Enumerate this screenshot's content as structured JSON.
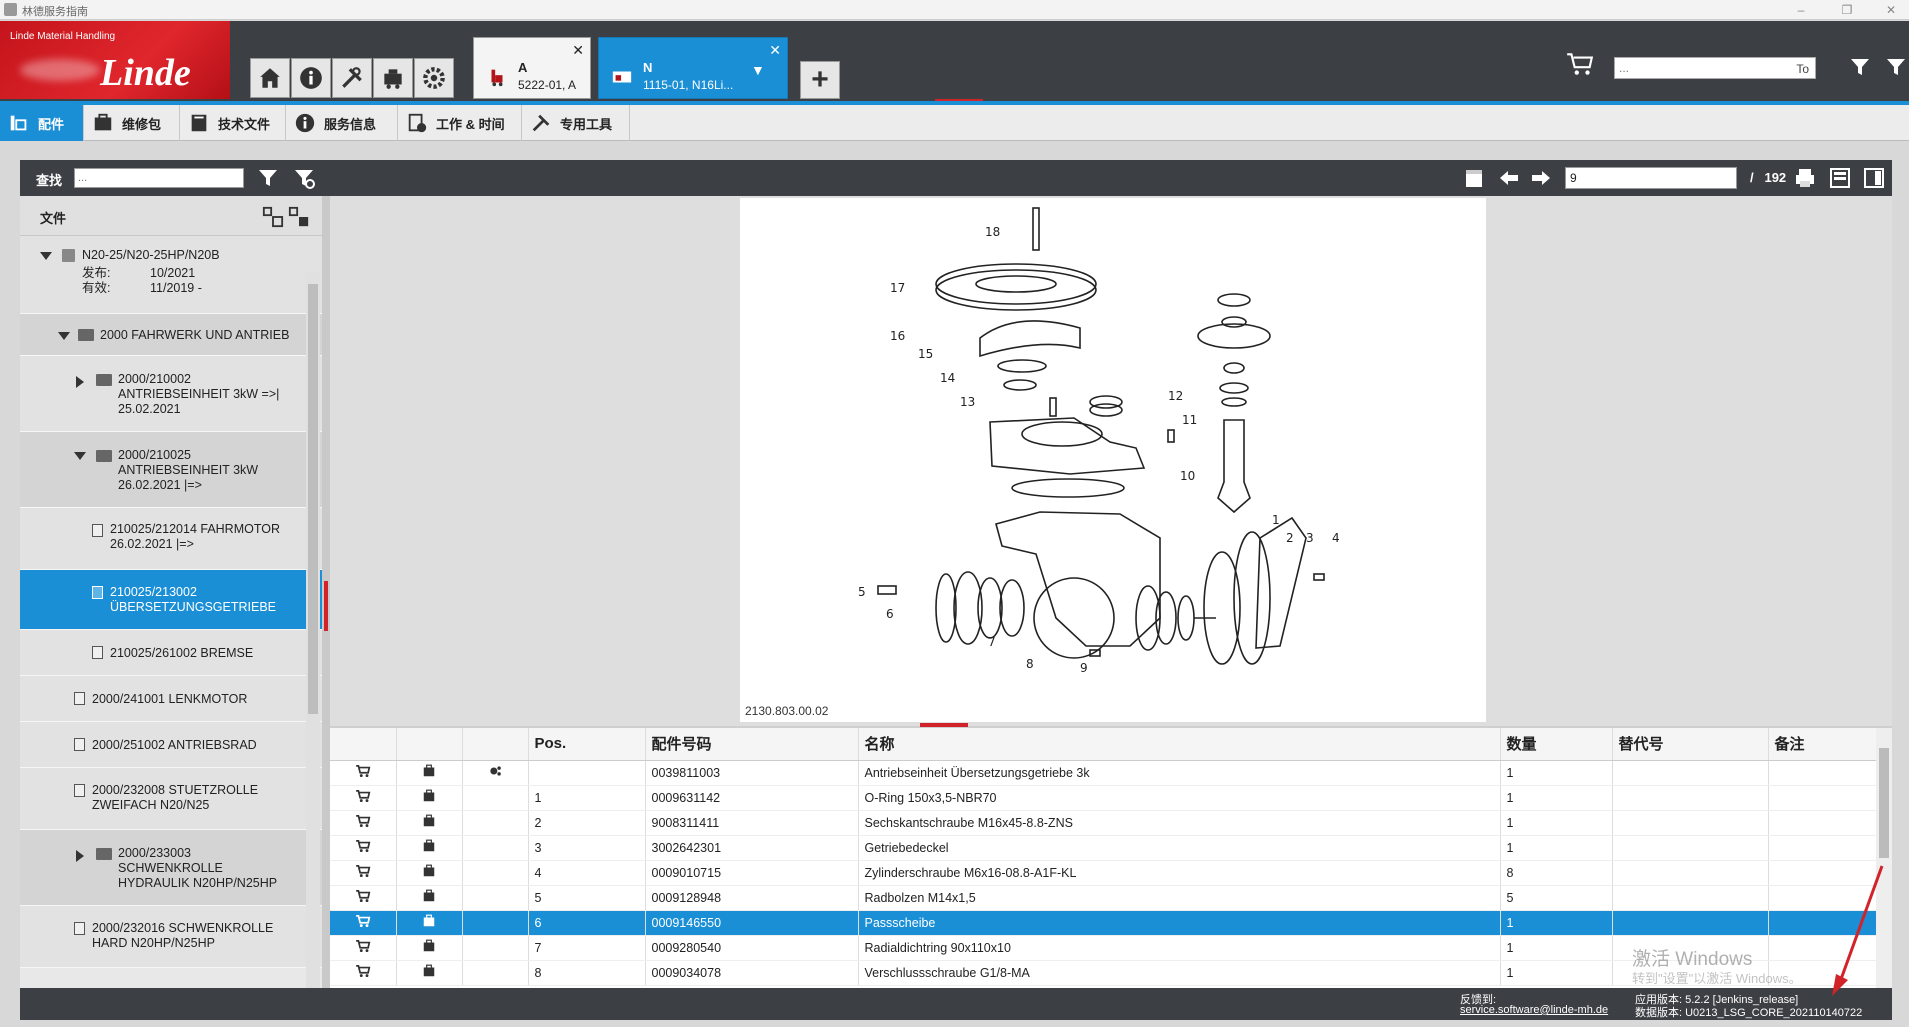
{
  "window": {
    "title": "林德服务指南"
  },
  "logo": {
    "small_text": "Linde Material Handling",
    "brand": "Linde"
  },
  "doc_tabs": [
    {
      "title": "A",
      "subtitle": "5222-01, A"
    },
    {
      "title": "N",
      "subtitle": "1115-01, N16Li..."
    }
  ],
  "header_search": {
    "placeholder": "...",
    "scope": "To"
  },
  "tool_tabs": [
    {
      "label": "配件",
      "icon": "parts-icon"
    },
    {
      "label": "维修包",
      "icon": "kit-icon"
    },
    {
      "label": "技术文件",
      "icon": "book-icon"
    },
    {
      "label": "服务信息",
      "icon": "info-icon"
    },
    {
      "label": "工作 & 时间",
      "icon": "clock-doc-icon"
    },
    {
      "label": "专用工具",
      "icon": "tools-icon"
    }
  ],
  "find": {
    "label": "查找",
    "placeholder": "..."
  },
  "page_nav": {
    "current": "9",
    "separator": "/",
    "total": "192"
  },
  "tree": {
    "header": "文件",
    "root": {
      "title": "N20-25/N20-25HP/N20B",
      "release_label": "发布:",
      "release": "10/2021",
      "valid_label": "有效:",
      "valid": "11/2019 -"
    },
    "nodes": [
      "2000 FAHRWERK UND ANTRIEB",
      "2000/210002\nANTRIEBSEINHEIT 3kW =>|\n25.02.2021",
      "2000/210025\nANTRIEBSEINHEIT 3kW\n26.02.2021 |=>",
      "210025/212014 FAHRMOTOR\n26.02.2021 |=>",
      "210025/213002\nÜBERSETZUNGSGETRIEBE",
      "210025/261002 BREMSE",
      "2000/241001 LENKMOTOR",
      "2000/251002 ANTRIEBSRAD",
      "2000/232008 STUETZROLLE\nZWEIFACH N20/N25",
      "2000/233003\nSCHWENKROLLE\nHYDRAULIK N20HP/N25HP",
      "2000/232016 SCHWENKROLLE\nHARD N20HP/N25HP"
    ]
  },
  "drawing": {
    "reference": "2130.803.00.02",
    "callouts": [
      "18",
      "17",
      "16",
      "15",
      "14",
      "13",
      "12",
      "11",
      "10",
      "1",
      "2",
      "3",
      "4",
      "5",
      "6",
      "7",
      "8",
      "9"
    ]
  },
  "parts_table": {
    "columns": [
      "",
      "",
      "",
      "Pos.",
      "配件号码",
      "名称",
      "数量",
      "替代号",
      "备注"
    ],
    "rows": [
      {
        "pos": "",
        "part": "0039811003",
        "name": "Antriebseinheit Übersetzungsgetriebe 3k",
        "qty": "1",
        "alt": "",
        "note": ""
      },
      {
        "pos": "1",
        "part": "0009631142",
        "name": "O-Ring 150x3,5-NBR70",
        "qty": "1",
        "alt": "",
        "note": ""
      },
      {
        "pos": "2",
        "part": "9008311411",
        "name": "Sechskantschraube M16x45-8.8-ZNS",
        "qty": "1",
        "alt": "",
        "note": ""
      },
      {
        "pos": "3",
        "part": "3002642301",
        "name": "Getriebedeckel",
        "qty": "1",
        "alt": "",
        "note": ""
      },
      {
        "pos": "4",
        "part": "0009010715",
        "name": "Zylinderschraube M6x16-08.8-A1F-KL",
        "qty": "8",
        "alt": "",
        "note": ""
      },
      {
        "pos": "5",
        "part": "0009128948",
        "name": "Radbolzen M14x1,5",
        "qty": "5",
        "alt": "",
        "note": ""
      },
      {
        "pos": "6",
        "part": "0009146550",
        "name": "Passscheibe",
        "qty": "1",
        "alt": "",
        "note": ""
      },
      {
        "pos": "7",
        "part": "0009280540",
        "name": "Radialdichtring 90x110x10",
        "qty": "1",
        "alt": "",
        "note": ""
      },
      {
        "pos": "8",
        "part": "0009034078",
        "name": "Verschlussschraube G1/8-MA",
        "qty": "1",
        "alt": "",
        "note": ""
      }
    ]
  },
  "footer": {
    "feedback_label": "反馈到:",
    "feedback_email": "service.software@linde-mh.de",
    "app_version": "应用版本: 5.2.2 [Jenkins_release]",
    "data_version": "数据版本: U0213_LSG_CORE_202110140722"
  },
  "os_watermark": {
    "line1": "激活 Windows",
    "line2": "转到\"设置\"以激活 Windows。"
  },
  "colors": {
    "accent": "#1a8fd6",
    "brand_red": "#d2232a",
    "bar_dark": "#3c3f43"
  }
}
